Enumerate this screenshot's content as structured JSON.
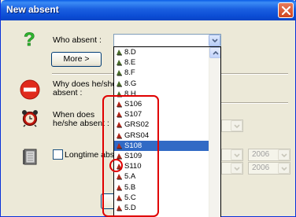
{
  "window": {
    "title": "New absent"
  },
  "who": {
    "label": "Who absent :",
    "more_button": "More >"
  },
  "why": {
    "label_line1": "Why does he/she",
    "label_line2": "absent :"
  },
  "when": {
    "label_line1": "When does",
    "label_line2": "he/she absent :"
  },
  "longtime": {
    "label": "Longtime absence",
    "year1": "2006",
    "year2": "2006"
  },
  "dropdown": {
    "items": [
      "8.D",
      "8.E",
      "8.F",
      "8.G",
      "8.H",
      "S106",
      "S107",
      "GRS02",
      "GRS04",
      "S108",
      "S109",
      "S110",
      "5.A",
      "5.B",
      "5.C",
      "5.D"
    ],
    "selected": "S108"
  },
  "colors": {
    "title_bar": "#0a5ce6",
    "dialog_bg": "#ece9d8",
    "selection": "#316ac5",
    "highlight": "#e00000"
  }
}
